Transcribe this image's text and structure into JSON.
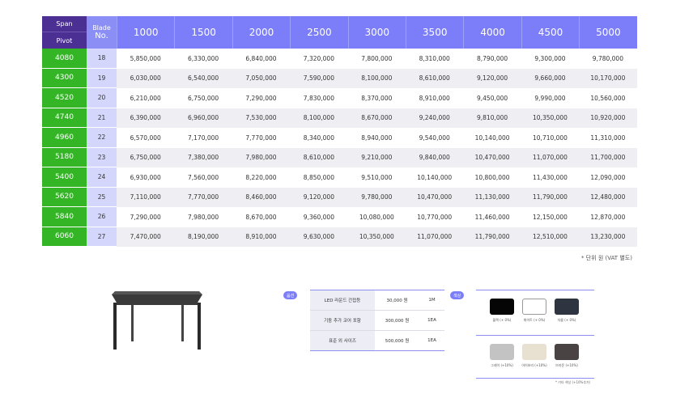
{
  "table": {
    "span_label": "Span",
    "pivot_label": "Pivot",
    "blade_label_1": "Blade",
    "blade_label_2": "No.",
    "columns": [
      "1000",
      "1500",
      "2000",
      "2500",
      "3000",
      "3500",
      "4000",
      "4500",
      "5000"
    ],
    "rows": [
      {
        "pivot": "4080",
        "blade": "18",
        "values": [
          "5,850,000",
          "6,330,000",
          "6,840,000",
          "7,320,000",
          "7,800,000",
          "8,310,000",
          "8,790,000",
          "9,300,000",
          "9,780,000"
        ]
      },
      {
        "pivot": "4300",
        "blade": "19",
        "values": [
          "6,030,000",
          "6,540,000",
          "7,050,000",
          "7,590,000",
          "8,100,000",
          "8,610,000",
          "9,120,000",
          "9,660,000",
          "10,170,000"
        ]
      },
      {
        "pivot": "4520",
        "blade": "20",
        "values": [
          "6,210,000",
          "6,750,000",
          "7,290,000",
          "7,830,000",
          "8,370,000",
          "8,910,000",
          "9,450,000",
          "9,990,000",
          "10,560,000"
        ]
      },
      {
        "pivot": "4740",
        "blade": "21",
        "values": [
          "6,390,000",
          "6,960,000",
          "7,530,000",
          "8,100,000",
          "8,670,000",
          "9,240,000",
          "9,810,000",
          "10,350,000",
          "10,920,000"
        ]
      },
      {
        "pivot": "4960",
        "blade": "22",
        "values": [
          "6,570,000",
          "7,170,000",
          "7,770,000",
          "8,340,000",
          "8,940,000",
          "9,540,000",
          "10,140,000",
          "10,710,000",
          "11,310,000"
        ]
      },
      {
        "pivot": "5180",
        "blade": "23",
        "values": [
          "6,750,000",
          "7,380,000",
          "7,980,000",
          "8,610,000",
          "9,210,000",
          "9,840,000",
          "10,470,000",
          "11,070,000",
          "11,700,000"
        ]
      },
      {
        "pivot": "5400",
        "blade": "24",
        "values": [
          "6,930,000",
          "7,560,000",
          "8,220,000",
          "8,850,000",
          "9,510,000",
          "10,140,000",
          "10,800,000",
          "11,430,000",
          "12,090,000"
        ]
      },
      {
        "pivot": "5620",
        "blade": "25",
        "values": [
          "7,110,000",
          "7,770,000",
          "8,460,000",
          "9,120,000",
          "9,780,000",
          "10,470,000",
          "11,130,000",
          "11,790,000",
          "12,480,000"
        ]
      },
      {
        "pivot": "5840",
        "blade": "26",
        "values": [
          "7,290,000",
          "7,980,000",
          "8,670,000",
          "9,360,000",
          "10,080,000",
          "10,770,000",
          "11,460,000",
          "12,150,000",
          "12,870,000"
        ]
      },
      {
        "pivot": "6060",
        "blade": "27",
        "values": [
          "7,470,000",
          "8,190,000",
          "8,910,000",
          "9,630,000",
          "10,350,000",
          "11,070,000",
          "11,790,000",
          "12,510,000",
          "13,230,000"
        ]
      }
    ],
    "unit_note": "* 단위 원 (VAT 별도)"
  },
  "options": {
    "badge": "옵션",
    "items": [
      {
        "name": "LED 라운드 간접등",
        "price": "30,000 원",
        "unit": "1M"
      },
      {
        "name": "기둥 추가 코어 포함",
        "price": "300,000 원",
        "unit": "1EA"
      },
      {
        "name": "표준 외 사이즈",
        "price": "500,000 원",
        "unit": "1EA"
      }
    ]
  },
  "colors": {
    "badge": "색상",
    "swatches": [
      {
        "label": "블랙 (+ 0%)",
        "color": "#050505"
      },
      {
        "label": "화이트 (+ 0%)",
        "color": "#ffffff"
      },
      {
        "label": "차콜 (+ 0%)",
        "color": "#2e3540"
      },
      {
        "label": "그레이 (+10%)",
        "color": "#c3c3c3"
      },
      {
        "label": "아이보리 (+10%)",
        "color": "#e8e1d2"
      },
      {
        "label": "브라운 (+10%)",
        "color": "#4a4343"
      }
    ],
    "note": "* 기타 색상 (+10%추가)"
  },
  "colors_theme": {
    "header": "#7b7ef8",
    "span_header": "#4b2f93",
    "pivot": "#33b526"
  },
  "product_image": {
    "icon": "pergola-icon"
  }
}
